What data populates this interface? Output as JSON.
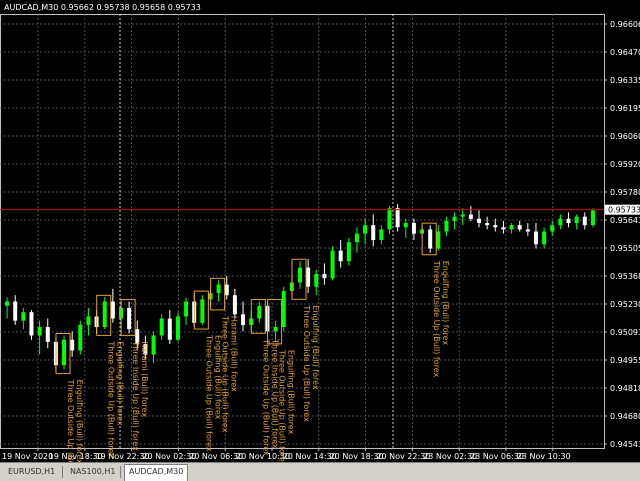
{
  "symbol_info": "AUDCAD,M30  0.95662 0.95738 0.95658 0.95733",
  "colors": {
    "background": "#000000",
    "grid": "#5a6470",
    "bull": "#00ff00",
    "bear": "#ffffff",
    "price_line": "#cc0000",
    "pattern": "#e0a030",
    "axis_text": "#ffffff"
  },
  "chart_data": {
    "type": "candlestick",
    "symbol": "AUDCAD",
    "timeframe": "M30",
    "ylim": [
      0.9461,
      0.96655
    ],
    "price_ticks": [
      "0.96655",
      "0.96520",
      "0.96380",
      "0.96240",
      "0.96105",
      "0.95965",
      "0.95820",
      "0.95685",
      "0.95545",
      "0.95405",
      "0.95270",
      "0.95130",
      "0.94990",
      "0.94855",
      "0.94715",
      "0.94575"
    ],
    "price_ticks_shown": [
      "0.96606",
      "0.96470",
      "0.96335",
      "0.96195",
      "0.96060",
      "0.95920",
      "0.95780",
      "0.95643",
      "0.95505",
      "0.95368",
      "0.95230",
      "0.95093",
      "0.94955",
      "0.94818",
      "0.94680",
      "0.94543"
    ],
    "y_axis_labels": [
      "0.96606",
      "0.96470",
      "0.96335",
      "0.96195",
      "0.96060",
      "0.95920",
      "0.95780",
      "0.95643",
      "0.95505",
      "0.95368",
      "0.95230",
      "0.95093",
      "0.94955",
      "0.94818",
      "0.94680",
      "0.94543"
    ],
    "time_labels": [
      "19 Nov 2020",
      "19 Nov 18:30",
      "19 Nov 22:30",
      "20 Nov 02:30",
      "20 Nov 06:30",
      "20 Nov 10:30",
      "20 Nov 14:30",
      "20 Nov 18:30",
      "20 Nov 22:30",
      "23 Nov 02:30",
      "23 Nov 06:30",
      "23 Nov 10:30"
    ],
    "current_price": "0.95733",
    "candles": [
      {
        "o": 0.9528,
        "h": 0.9532,
        "l": 0.9522,
        "c": 0.953
      },
      {
        "o": 0.953,
        "h": 0.9533,
        "l": 0.9519,
        "c": 0.9521
      },
      {
        "o": 0.9521,
        "h": 0.9527,
        "l": 0.9517,
        "c": 0.9525
      },
      {
        "o": 0.9525,
        "h": 0.9526,
        "l": 0.9512,
        "c": 0.9514
      },
      {
        "o": 0.9514,
        "h": 0.9521,
        "l": 0.9505,
        "c": 0.9518
      },
      {
        "o": 0.9518,
        "h": 0.9522,
        "l": 0.9508,
        "c": 0.9511
      },
      {
        "o": 0.9511,
        "h": 0.9513,
        "l": 0.9497,
        "c": 0.95
      },
      {
        "o": 0.95,
        "h": 0.9514,
        "l": 0.9498,
        "c": 0.9512
      },
      {
        "o": 0.9512,
        "h": 0.9516,
        "l": 0.9504,
        "c": 0.9507
      },
      {
        "o": 0.9507,
        "h": 0.9521,
        "l": 0.9505,
        "c": 0.9519
      },
      {
        "o": 0.9519,
        "h": 0.9527,
        "l": 0.9514,
        "c": 0.9523
      },
      {
        "o": 0.9523,
        "h": 0.9526,
        "l": 0.9515,
        "c": 0.9518
      },
      {
        "o": 0.9518,
        "h": 0.9532,
        "l": 0.9517,
        "c": 0.953
      },
      {
        "o": 0.953,
        "h": 0.9536,
        "l": 0.952,
        "c": 0.9522
      },
      {
        "o": 0.9522,
        "h": 0.9529,
        "l": 0.9518,
        "c": 0.9527
      },
      {
        "o": 0.9527,
        "h": 0.953,
        "l": 0.9515,
        "c": 0.9517
      },
      {
        "o": 0.9517,
        "h": 0.9521,
        "l": 0.9507,
        "c": 0.951
      },
      {
        "o": 0.951,
        "h": 0.9514,
        "l": 0.9503,
        "c": 0.9505
      },
      {
        "o": 0.9505,
        "h": 0.9516,
        "l": 0.9501,
        "c": 0.9514
      },
      {
        "o": 0.9514,
        "h": 0.9524,
        "l": 0.9512,
        "c": 0.9522
      },
      {
        "o": 0.9522,
        "h": 0.9526,
        "l": 0.951,
        "c": 0.9512
      },
      {
        "o": 0.9512,
        "h": 0.9525,
        "l": 0.9511,
        "c": 0.9523
      },
      {
        "o": 0.9523,
        "h": 0.9532,
        "l": 0.9519,
        "c": 0.953
      },
      {
        "o": 0.953,
        "h": 0.9534,
        "l": 0.9518,
        "c": 0.952
      },
      {
        "o": 0.952,
        "h": 0.9533,
        "l": 0.9519,
        "c": 0.9531
      },
      {
        "o": 0.9531,
        "h": 0.9537,
        "l": 0.9527,
        "c": 0.9534
      },
      {
        "o": 0.9534,
        "h": 0.954,
        "l": 0.953,
        "c": 0.9538
      },
      {
        "o": 0.9538,
        "h": 0.9542,
        "l": 0.9531,
        "c": 0.9533
      },
      {
        "o": 0.9533,
        "h": 0.9536,
        "l": 0.9522,
        "c": 0.9524
      },
      {
        "o": 0.9524,
        "h": 0.953,
        "l": 0.9516,
        "c": 0.9519
      },
      {
        "o": 0.9519,
        "h": 0.9526,
        "l": 0.9516,
        "c": 0.9522
      },
      {
        "o": 0.9522,
        "h": 0.953,
        "l": 0.952,
        "c": 0.9528
      },
      {
        "o": 0.9528,
        "h": 0.953,
        "l": 0.9514,
        "c": 0.9516
      },
      {
        "o": 0.9516,
        "h": 0.9521,
        "l": 0.9511,
        "c": 0.9518
      },
      {
        "o": 0.9518,
        "h": 0.9537,
        "l": 0.9516,
        "c": 0.9535
      },
      {
        "o": 0.9535,
        "h": 0.9542,
        "l": 0.9532,
        "c": 0.9539
      },
      {
        "o": 0.9539,
        "h": 0.9549,
        "l": 0.9536,
        "c": 0.9546
      },
      {
        "o": 0.9546,
        "h": 0.955,
        "l": 0.9534,
        "c": 0.9537
      },
      {
        "o": 0.9537,
        "h": 0.9545,
        "l": 0.9533,
        "c": 0.9543
      },
      {
        "o": 0.9543,
        "h": 0.9548,
        "l": 0.9538,
        "c": 0.9541
      },
      {
        "o": 0.9541,
        "h": 0.9556,
        "l": 0.954,
        "c": 0.9554
      },
      {
        "o": 0.9554,
        "h": 0.9559,
        "l": 0.9546,
        "c": 0.9549
      },
      {
        "o": 0.9549,
        "h": 0.956,
        "l": 0.9547,
        "c": 0.9558
      },
      {
        "o": 0.9558,
        "h": 0.9565,
        "l": 0.9553,
        "c": 0.9562
      },
      {
        "o": 0.9562,
        "h": 0.9569,
        "l": 0.9557,
        "c": 0.9566
      },
      {
        "o": 0.9566,
        "h": 0.9571,
        "l": 0.9556,
        "c": 0.9559
      },
      {
        "o": 0.9559,
        "h": 0.9566,
        "l": 0.9557,
        "c": 0.9564
      },
      {
        "o": 0.9564,
        "h": 0.9575,
        "l": 0.9562,
        "c": 0.9574
      },
      {
        "o": 0.9574,
        "h": 0.9576,
        "l": 0.9563,
        "c": 0.9565
      },
      {
        "o": 0.9565,
        "h": 0.9569,
        "l": 0.956,
        "c": 0.9567
      },
      {
        "o": 0.9567,
        "h": 0.9569,
        "l": 0.9559,
        "c": 0.9562
      },
      {
        "o": 0.9562,
        "h": 0.9566,
        "l": 0.956,
        "c": 0.9564
      },
      {
        "o": 0.9564,
        "h": 0.9566,
        "l": 0.9553,
        "c": 0.9555
      },
      {
        "o": 0.9555,
        "h": 0.9566,
        "l": 0.9554,
        "c": 0.9563
      },
      {
        "o": 0.9563,
        "h": 0.957,
        "l": 0.9561,
        "c": 0.9568
      },
      {
        "o": 0.9568,
        "h": 0.9572,
        "l": 0.9564,
        "c": 0.957
      },
      {
        "o": 0.957,
        "h": 0.9574,
        "l": 0.9566,
        "c": 0.9571
      },
      {
        "o": 0.9571,
        "h": 0.9575,
        "l": 0.9568,
        "c": 0.9569
      },
      {
        "o": 0.9569,
        "h": 0.9573,
        "l": 0.9565,
        "c": 0.9567
      },
      {
        "o": 0.9567,
        "h": 0.957,
        "l": 0.9564,
        "c": 0.9566
      },
      {
        "o": 0.9566,
        "h": 0.9569,
        "l": 0.9563,
        "c": 0.9565
      },
      {
        "o": 0.9565,
        "h": 0.9568,
        "l": 0.9562,
        "c": 0.9564
      },
      {
        "o": 0.9564,
        "h": 0.9567,
        "l": 0.9562,
        "c": 0.9566
      },
      {
        "o": 0.9566,
        "h": 0.9568,
        "l": 0.9563,
        "c": 0.9564
      },
      {
        "o": 0.9564,
        "h": 0.9567,
        "l": 0.9561,
        "c": 0.9563
      },
      {
        "o": 0.9563,
        "h": 0.9567,
        "l": 0.9555,
        "c": 0.9557
      },
      {
        "o": 0.9557,
        "h": 0.9565,
        "l": 0.9555,
        "c": 0.9563
      },
      {
        "o": 0.9563,
        "h": 0.9568,
        "l": 0.9561,
        "c": 0.9566
      },
      {
        "o": 0.9566,
        "h": 0.9571,
        "l": 0.9564,
        "c": 0.9569
      },
      {
        "o": 0.9569,
        "h": 0.9572,
        "l": 0.9565,
        "c": 0.9567
      },
      {
        "o": 0.9567,
        "h": 0.9571,
        "l": 0.9564,
        "c": 0.957
      },
      {
        "o": 0.957,
        "h": 0.9572,
        "l": 0.9564,
        "c": 0.9566
      },
      {
        "o": 0.9566,
        "h": 0.9574,
        "l": 0.9565,
        "c": 0.9573
      }
    ],
    "patterns": [
      {
        "candle": 7,
        "text": "Three Outside Up (Bull) forex"
      },
      {
        "candle": 7,
        "text": "Engulfing (Bull) forex"
      },
      {
        "candle": 12,
        "text": "Three Outside Up (Bull) forex"
      },
      {
        "candle": 12,
        "text": "Engulfing (Bull) forex"
      },
      {
        "candle": 15,
        "text": "Three Inside Up (Bull) forex"
      },
      {
        "candle": 15,
        "text": "Harami (Bull) forex"
      },
      {
        "candle": 24,
        "text": "Three Outside Up (Bull) forex"
      },
      {
        "candle": 24,
        "text": "Engulfing (Bull) forex"
      },
      {
        "candle": 26,
        "text": "Three Outside Up (Bull) forex"
      },
      {
        "candle": 26,
        "text": "Harami (Bull) forex"
      },
      {
        "candle": 31,
        "text": "Three Outside Up (Bull) forex"
      },
      {
        "candle": 31,
        "text": "Three Inside Up (Bull) forex"
      },
      {
        "candle": 33,
        "text": "Three Outside Up (Bull) forex"
      },
      {
        "candle": 33,
        "text": "Engulfing (Bull) forex"
      },
      {
        "candle": 36,
        "text": "Three Outside Up (Bull) forex"
      },
      {
        "candle": 36,
        "text": "Engulfing (Bull) forex"
      },
      {
        "candle": 52,
        "text": "Three Outside Up (Bull) forex"
      },
      {
        "candle": 52,
        "text": "Engulfing (Bull) forex"
      }
    ]
  },
  "tabs": [
    {
      "label": "EURUSD,H1"
    },
    {
      "label": "NAS100,H1"
    },
    {
      "label": "AUDCAD,M30"
    }
  ]
}
